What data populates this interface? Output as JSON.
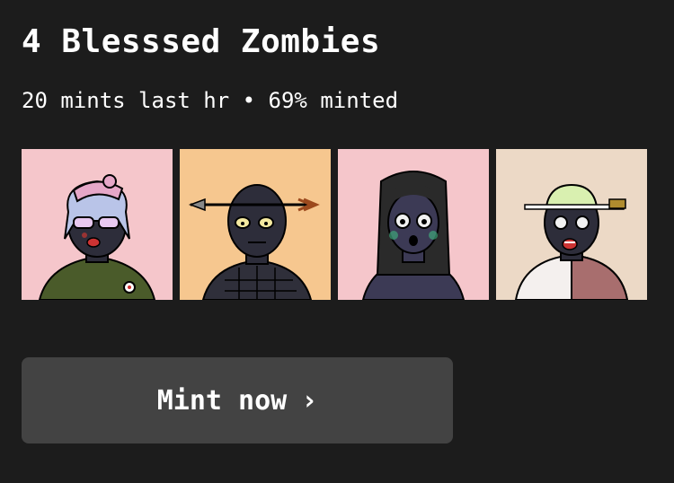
{
  "header": {
    "title": "4 Blesssed Zombies",
    "subtitle": "20 mints last hr • 69% minted"
  },
  "gallery": {
    "items": [
      {
        "bg": "#f5c6cb",
        "label": "zombie-1"
      },
      {
        "bg": "#f6c78f",
        "label": "zombie-2"
      },
      {
        "bg": "#f5c6cb",
        "label": "zombie-3"
      },
      {
        "bg": "#ecd9c6",
        "label": "zombie-4"
      }
    ]
  },
  "actions": {
    "mint_label": "Mint now",
    "mint_icon": "chevron-right-icon"
  },
  "colors": {
    "background": "#1c1c1c",
    "button": "#434343",
    "text": "#ffffff"
  }
}
